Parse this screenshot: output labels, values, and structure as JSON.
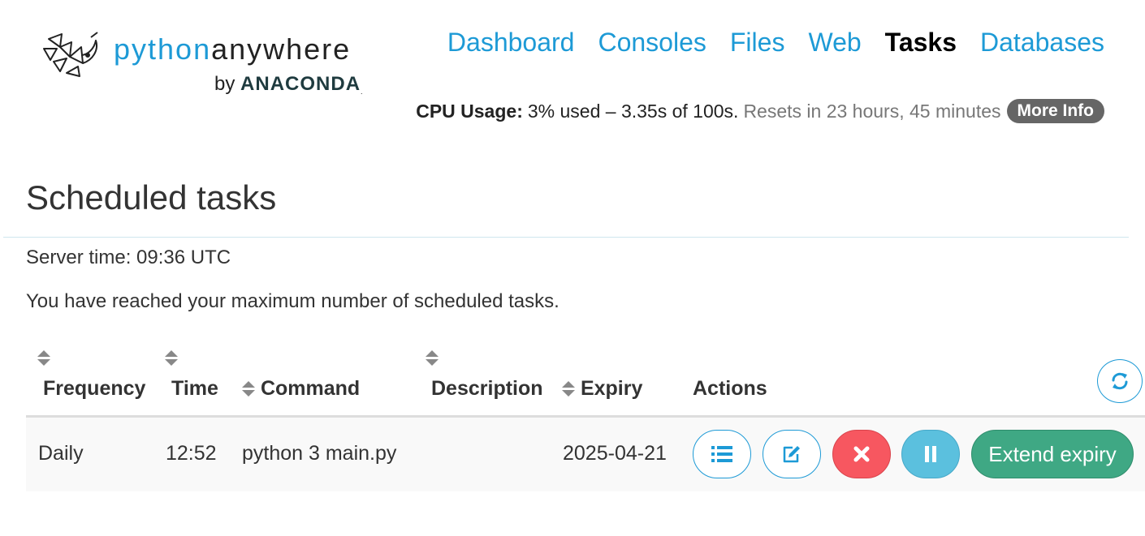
{
  "logo": {
    "word_part1": "python",
    "word_part2": "anywhere",
    "by": "by",
    "brand": "ANACONDA",
    "reg": "."
  },
  "nav": [
    {
      "label": "Dashboard",
      "active": false
    },
    {
      "label": "Consoles",
      "active": false
    },
    {
      "label": "Files",
      "active": false
    },
    {
      "label": "Web",
      "active": false
    },
    {
      "label": "Tasks",
      "active": true
    },
    {
      "label": "Databases",
      "active": false
    }
  ],
  "cpu": {
    "label": "CPU Usage:",
    "usage": "3% used – 3.35s of 100s.",
    "reset": "Resets in 23 hours, 45 minutes",
    "more_info": "More Info"
  },
  "page": {
    "title": "Scheduled tasks",
    "server_time": "Server time: 09:36 UTC",
    "max_message": "You have reached your maximum number of scheduled tasks."
  },
  "table": {
    "headers": {
      "frequency": "Frequency",
      "time": "Time",
      "command": "Command",
      "description": "Description",
      "expiry": "Expiry",
      "actions": "Actions"
    },
    "rows": [
      {
        "frequency": "Daily",
        "time": "12:52",
        "command": "python 3 main.py",
        "description": "",
        "expiry": "2025-04-21",
        "extend_label": "Extend expiry"
      }
    ]
  },
  "icons": {
    "refresh": "refresh-icon",
    "log": "list-icon",
    "edit": "edit-icon",
    "delete": "times-icon",
    "pause": "pause-icon"
  },
  "colors": {
    "brand_blue": "#1d9ad6",
    "delete_red": "#f75760",
    "pause_blue": "#5bc0de",
    "extend_green": "#3fa884",
    "badge_gray": "#666666"
  }
}
